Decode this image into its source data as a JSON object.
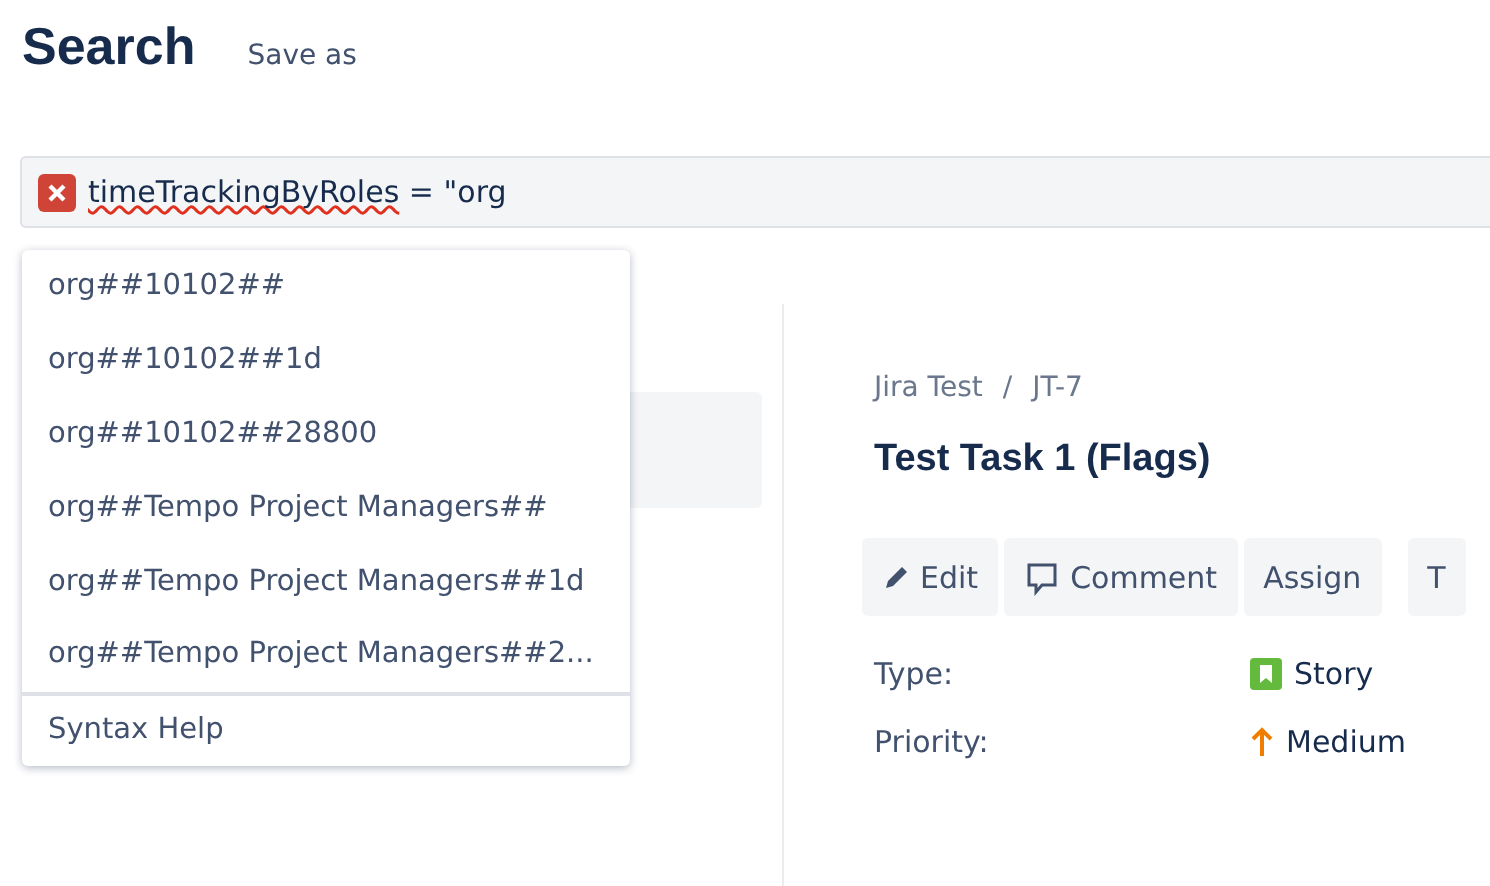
{
  "header": {
    "title": "Search",
    "save_as": "Save as"
  },
  "query": {
    "error": true,
    "misspelled": "timeTrackingByRoles",
    "rest": " = \"org"
  },
  "suggestions": [
    "org##10102##",
    "org##10102##1d",
    "org##10102##28800",
    "org##Tempo Project Managers##",
    "org##Tempo Project Managers##1d",
    "org##Tempo Project Managers##2..."
  ],
  "syntax_help": "Syntax Help",
  "issue": {
    "breadcrumbs": [
      "Jira Test",
      "JT-7"
    ],
    "breadcrumb_separator": "/",
    "title": "Test Task 1 (Flags)",
    "actions": [
      {
        "kind": "edit",
        "label": "Edit"
      },
      {
        "kind": "comment",
        "label": "Comment"
      },
      {
        "kind": "plain",
        "label": "Assign"
      },
      {
        "kind": "plain",
        "label": "T"
      }
    ],
    "fields": [
      {
        "label": "Type:",
        "kind": "story",
        "value": "Story"
      },
      {
        "label": "Priority:",
        "kind": "priority",
        "value": "Medium"
      }
    ]
  }
}
